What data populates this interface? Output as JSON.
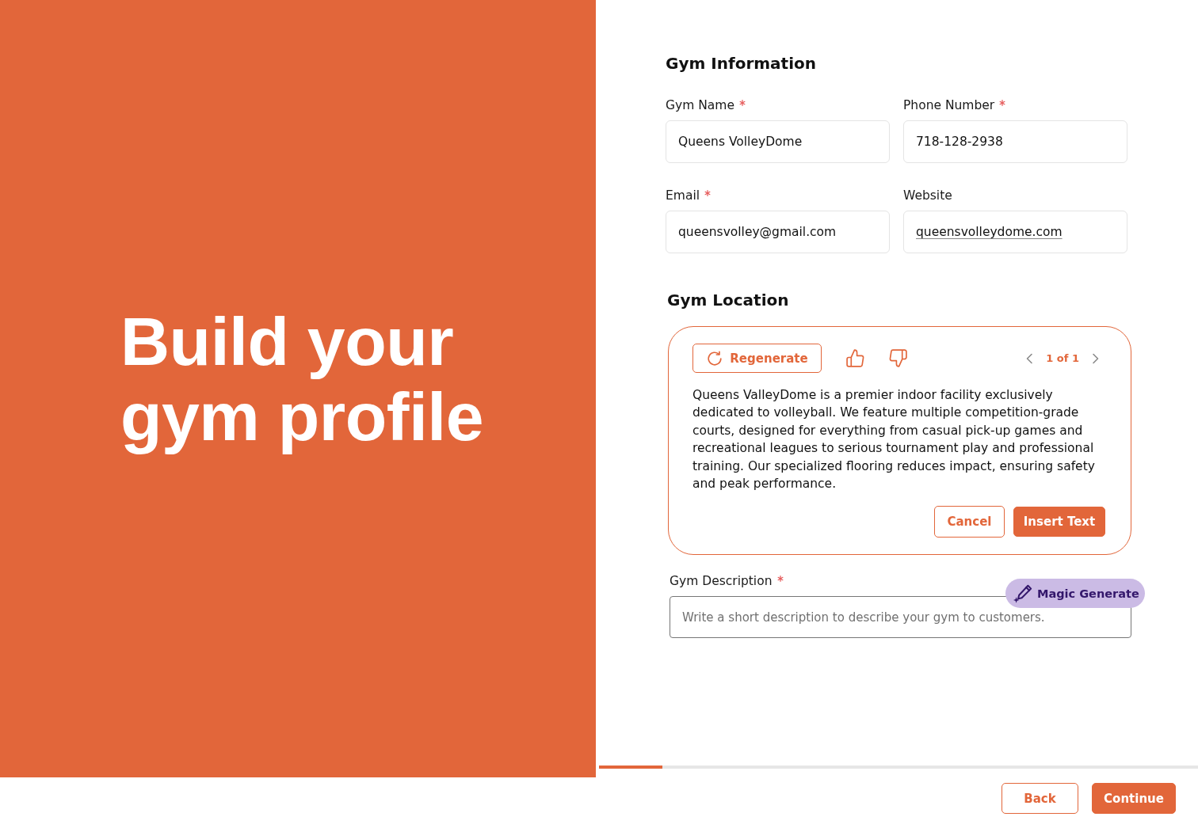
{
  "hero": {
    "title": "Build your gym profile"
  },
  "sections": [
    {
      "title": "Gym Information",
      "fields": [
        {
          "label": "Gym Name",
          "required": true,
          "value": "Queens VolleyDome",
          "kind": "text"
        },
        {
          "label": "Phone Number",
          "required": true,
          "value": "718-128-2938",
          "kind": "text"
        },
        {
          "label": "Email",
          "required": true,
          "value": "queensvolley@gmail.com",
          "kind": "text"
        },
        {
          "label": "Website",
          "required": false,
          "value": "queensvolleydome.com",
          "kind": "link"
        }
      ]
    },
    {
      "title": "Gym Location"
    }
  ],
  "ai_popup": {
    "regenerate_button": "Regenerate",
    "pager": "1 of 1",
    "text": "Queens ValleyDome is a premier indoor facility exclusively dedicated to volleyball. We feature multiple competition-grade courts, designed for everything from casual pick-up games and recreational leagues to serious tournament play and professional training. Our specialized flooring reduces impact, ensuring safety and peak performance.",
    "buttons": [
      {
        "label": "Cancel",
        "kind": "outline"
      },
      {
        "label": "Insert Text",
        "kind": "primary"
      }
    ]
  },
  "description_field": {
    "label": "Gym Description",
    "required": true,
    "placeholder": "Write a short description to describe your gym to customers.",
    "magic_button": "Magic Generate"
  },
  "progress": {
    "level": 0.106
  },
  "footer_buttons": [
    {
      "label": "Back",
      "kind": "outline"
    },
    {
      "label": "Continue",
      "kind": "primary"
    }
  ]
}
